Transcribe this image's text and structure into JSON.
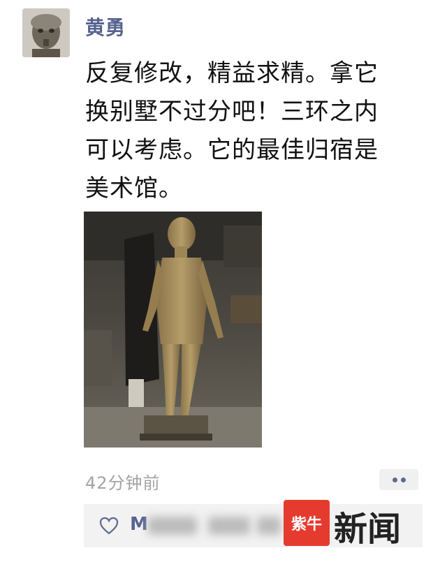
{
  "post": {
    "author": "黄勇",
    "text_lines": [
      "反复修改，精益求精。拿它",
      "换别墅不过分吧！三环之内",
      "可以考虑。它的最佳归宿是",
      "美术馆。"
    ],
    "time": "42分钟前",
    "likes_first_name": "M"
  },
  "watermark": {
    "badge": "紫牛",
    "text": "新闻"
  },
  "icons": {
    "more": "more-dots-icon",
    "heart": "heart-icon"
  },
  "colors": {
    "name": "#56638f",
    "time": "#a3a3a3",
    "watermark_red": "#e53b2f"
  }
}
